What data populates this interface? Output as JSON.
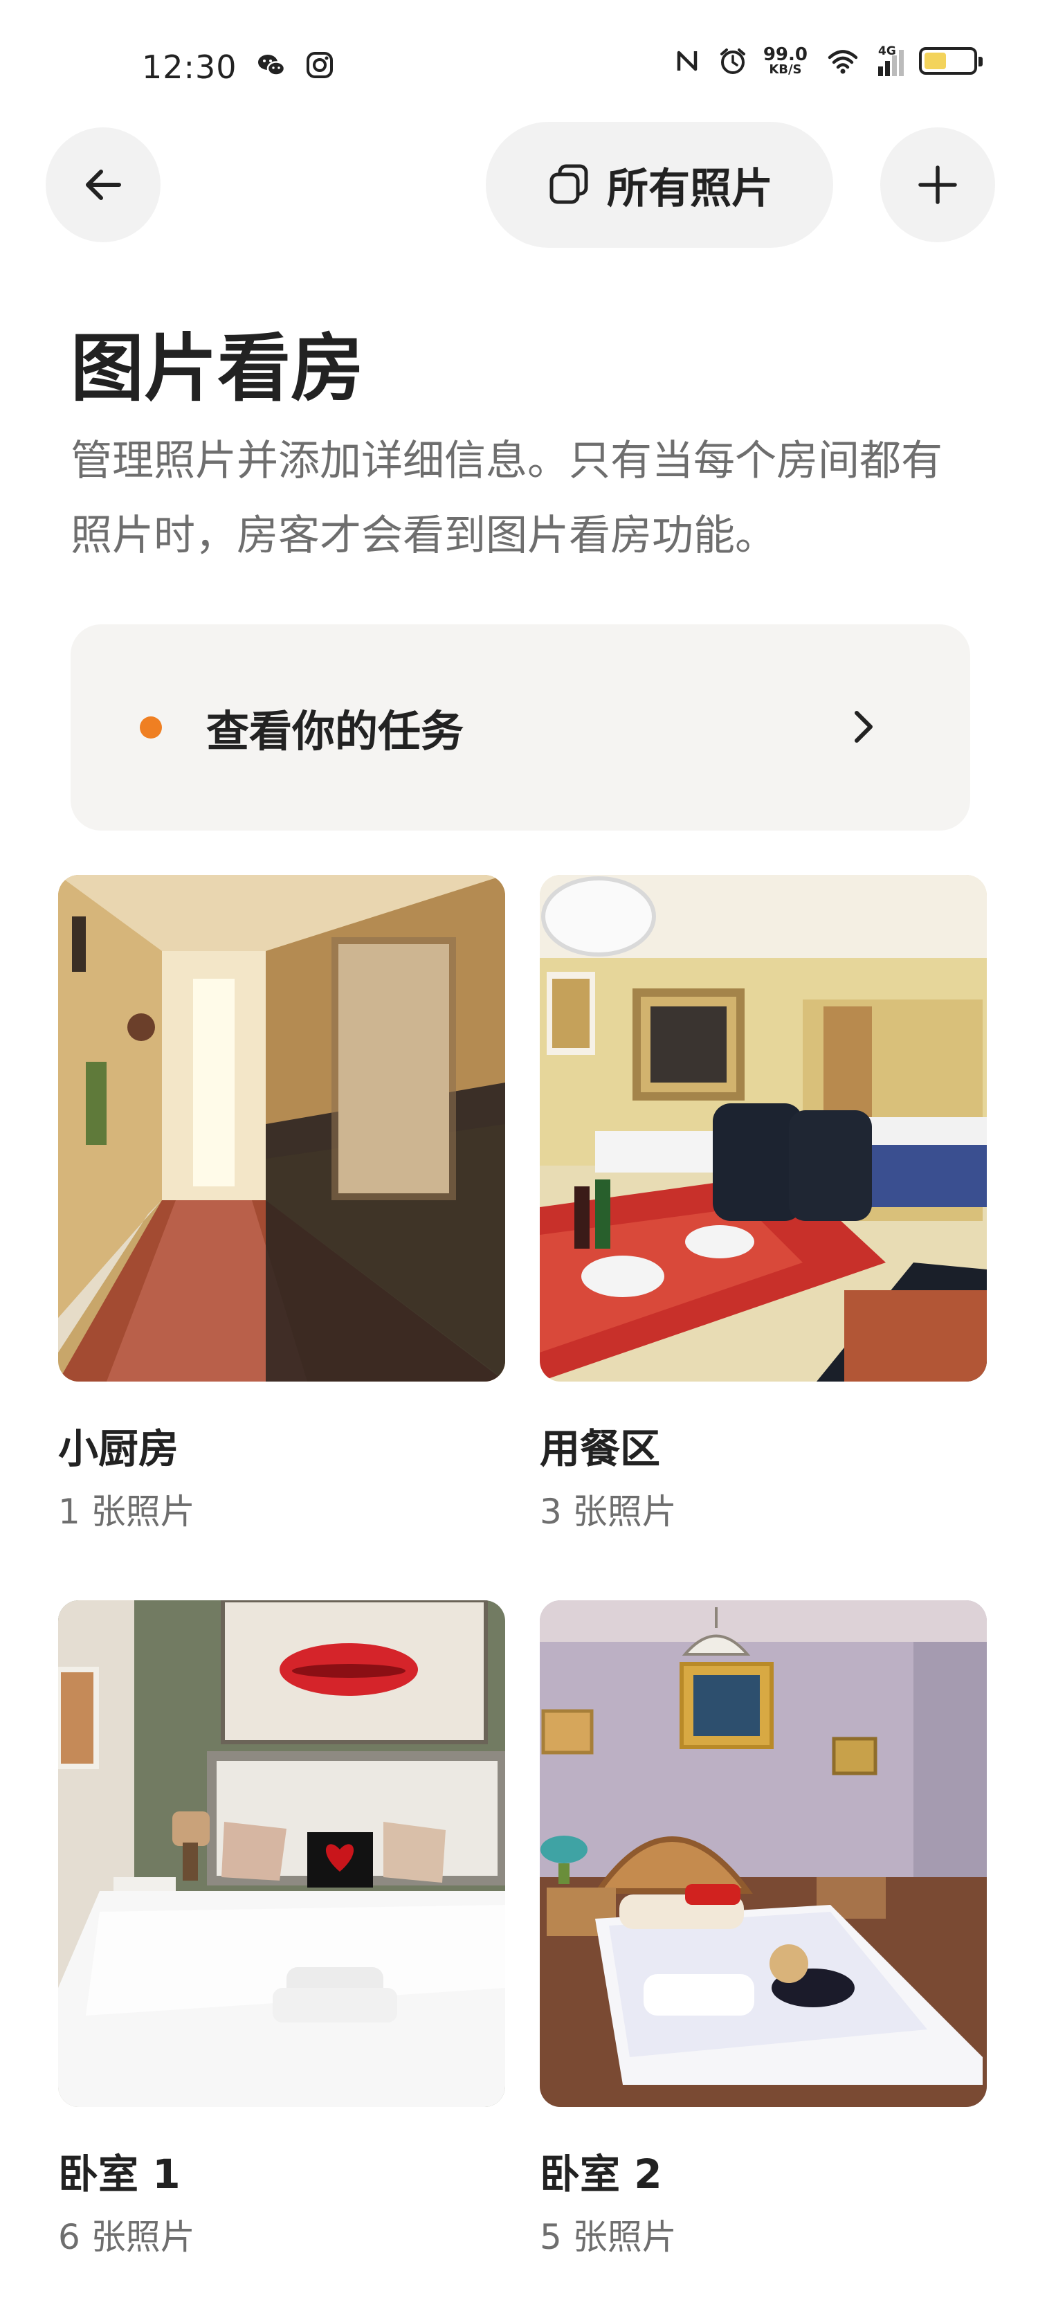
{
  "status_bar": {
    "time": "12:30",
    "left_icons": [
      "wechat-icon",
      "instagram-icon"
    ],
    "right_icons": [
      "nfc-icon",
      "alarm-icon",
      "wifi-icon",
      "signal-4g-icon",
      "battery-icon"
    ],
    "net_speed_value": "99.0",
    "net_speed_unit": "KB/S",
    "network_label": "4G",
    "battery_level": 0.45,
    "battery_color": "#f3d35b"
  },
  "nav": {
    "back_icon": "arrow-left-icon",
    "all_photos_label": "所有照片",
    "all_photos_icon": "photos-stack-icon",
    "add_icon": "plus-icon"
  },
  "header": {
    "title": "图片看房",
    "description": "管理照片并添加详细信息。只有当每个房间都有照片时，房客才会看到图片看房功能。"
  },
  "task_card": {
    "label": "查看你的任务",
    "dot_color": "#ef7f22",
    "chevron_icon": "chevron-right-icon"
  },
  "rooms": [
    {
      "name": "小厨房",
      "count": "1 张照片",
      "photo": "hallway-photo"
    },
    {
      "name": "用餐区",
      "count": "3 张照片",
      "photo": "dining-room-photo"
    },
    {
      "name": "卧室 1",
      "count": "6 张照片",
      "photo": "bedroom-photo"
    },
    {
      "name": "卧室 2",
      "count": "5 张照片",
      "photo": "bedroom-photo"
    }
  ]
}
